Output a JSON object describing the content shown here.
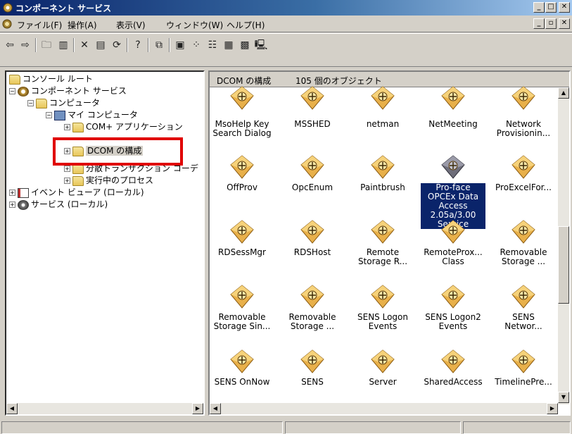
{
  "window": {
    "title": "コンポーネント サービス"
  },
  "menu": {
    "items": [
      "ファイル(F)",
      "操作(A)",
      "表示(V)",
      "ウィンドウ(W)",
      "ヘルプ(H)"
    ]
  },
  "tree": {
    "items": [
      {
        "label": "コンソール ルート"
      },
      {
        "label": "コンポーネント サービス"
      },
      {
        "label": "コンピュータ"
      },
      {
        "label": "マイ コンピュータ"
      },
      {
        "label": "COM+ アプリケーション"
      },
      {
        "label": "DCOM の構成"
      },
      {
        "label": "分散トランザクション コーデ"
      },
      {
        "label": "実行中のプロセス"
      },
      {
        "label": "イベント ビューア (ローカル)"
      },
      {
        "label": "サービス (ローカル)"
      }
    ]
  },
  "content": {
    "header_title": "DCOM の構成",
    "header_count": "105 個のオブジェクト",
    "icons": [
      "MsoHelp Key\nSearch Dialog",
      "MSSHED",
      "netman",
      "NetMeeting",
      "Network\nProvisionin...",
      "OffProv",
      "OpcEnum",
      "Paintbrush",
      "Pro-face\nOPCEx Data\nAccess\n2.05a/3.00\nService",
      "ProExcelFor...",
      "RDSessMgr",
      "RDSHost",
      "Remote\nStorage R...",
      "RemoteProx...\nClass",
      "Removable\nStorage ...",
      "Removable\nStorage Sin...",
      "Removable\nStorage ...",
      "SENS Logon\nEvents",
      "SENS Logon2\nEvents",
      "SENS\nNetwor...",
      "SENS OnNow",
      "SENS",
      "Server",
      "SharedAccess",
      "TimelinePre..."
    ],
    "selected_index": 8
  },
  "colors": {
    "titlebar": "#0a246a",
    "selection": "#0a246a",
    "highlight_box": "#e00000",
    "gem_gold": "#e8b04a"
  }
}
